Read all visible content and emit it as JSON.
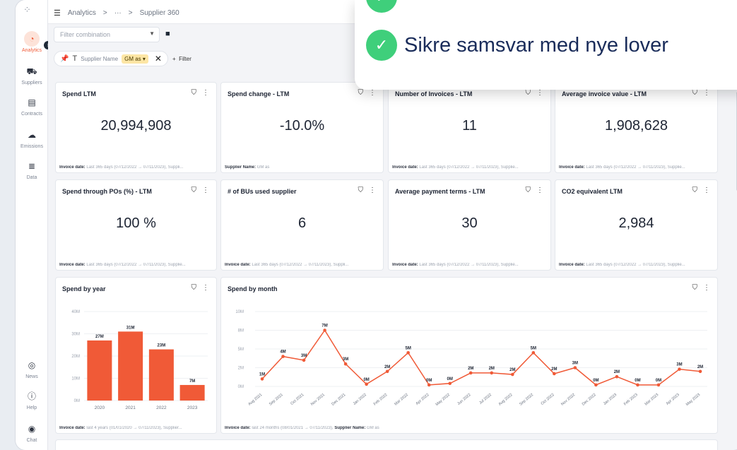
{
  "breadcrumb": {
    "root": "Analytics",
    "sep": ">",
    "ellipsis": "···",
    "current": "Supplier 360"
  },
  "sidebar": {
    "items": [
      {
        "label": "Analytics",
        "icon": "chart-icon",
        "active": true
      },
      {
        "label": "Suppliers",
        "icon": "truck-icon"
      },
      {
        "label": "Contracts",
        "icon": "document-icon"
      },
      {
        "label": "Emissions",
        "icon": "cloud-icon"
      },
      {
        "label": "Data",
        "icon": "database-icon"
      },
      {
        "label": "News",
        "icon": "news-icon"
      },
      {
        "label": "Help",
        "icon": "help-icon"
      },
      {
        "label": "Chat",
        "icon": "chat-icon"
      }
    ]
  },
  "filters": {
    "combination_placeholder": "Filter combination",
    "chip_label": "Supplier Name",
    "chip_value": "GM as",
    "add_filter": "Filter"
  },
  "kpis": [
    {
      "title": "Spend LTM",
      "value": "20,994,908",
      "foot_label": "Invoice date:",
      "foot_text": "Last 365 days (07/12/2022 → 07/11/2023), Suppli..."
    },
    {
      "title": "Spend change - LTM",
      "value": "-10.0%",
      "foot_label": "Supplier Name:",
      "foot_text": "GM as"
    },
    {
      "title": "Number of Invoices - LTM",
      "value": "11",
      "foot_label": "Invoice date:",
      "foot_text": "Last 365 days (07/12/2022 → 07/11/2023), Supplie..."
    },
    {
      "title": "Average invoice value - LTM",
      "value": "1,908,628",
      "foot_label": "Invoice date:",
      "foot_text": "Last 365 days (07/12/2022 → 07/11/2023), Supplie..."
    },
    {
      "title": "Spend through POs (%) - LTM",
      "value": "100 %",
      "foot_label": "Invoice date:",
      "foot_text": "Last 365 days (07/12/2022 → 07/11/2023), Supplie..."
    },
    {
      "title": "# of BUs used supplier",
      "value": "6",
      "foot_label": "Invoice date:",
      "foot_text": "Last 365 days (07/12/2022 → 07/11/2023), Suppli..."
    },
    {
      "title": "Average payment terms - LTM",
      "value": "30",
      "foot_label": "Invoice date:",
      "foot_text": "Last 365 days (07/12/2022 → 07/11/2023), Supplie..."
    },
    {
      "title": "CO2 equivalent LTM",
      "value": "2,984",
      "foot_label": "Invoice date:",
      "foot_text": "Last 365 days (07/12/2022 → 07/11/2023), Supplie..."
    }
  ],
  "year_card": {
    "title": "Spend by year",
    "foot_label": "Invoice date:",
    "foot_text": "last 4 years (01/01/2020 → 07/11/2023), Supplier..."
  },
  "month_card": {
    "title": "Spend by month",
    "foot_label": "Invoice date:",
    "foot_text": "last 24 months (08/01/2021 → 07/11/2023),",
    "foot_label2": "Supplier Name:",
    "foot_text2": "GM as"
  },
  "toast": {
    "line1": "",
    "line2": "Sikre samsvar med nye lover"
  },
  "colors": {
    "accent": "#f05a37",
    "success": "#3fcf7b",
    "text": "#1d2433"
  },
  "chart_data": [
    {
      "type": "bar",
      "title": "Spend by year",
      "categories": [
        "2020",
        "2021",
        "2022",
        "2023"
      ],
      "values": [
        27,
        31,
        23,
        7
      ],
      "labels": [
        "27M",
        "31M",
        "23M",
        "7M"
      ],
      "yticks": [
        "0M",
        "10M",
        "20M",
        "30M",
        "40M"
      ],
      "ylim": [
        0,
        40
      ],
      "unit": "M",
      "color": "#f05a37"
    },
    {
      "type": "line",
      "title": "Spend by month",
      "categories": [
        "Aug 2021",
        "Sep 2021",
        "Oct 2021",
        "Nov 2021",
        "Dec 2021",
        "Jan 2022",
        "Feb 2022",
        "Mar 2022",
        "Apr 2022",
        "May 2022",
        "Jun 2022",
        "Jul 2022",
        "Aug 2022",
        "Sep 2022",
        "Oct 2022",
        "Nov 2022",
        "Dec 2022",
        "Jan 2023",
        "Feb 2023",
        "Mar 2023",
        "Apr 2023",
        "May 2023"
      ],
      "values": [
        1,
        4,
        3.5,
        7.5,
        3,
        0.3,
        2,
        4.5,
        0.2,
        0.4,
        1.8,
        1.8,
        1.6,
        4.5,
        1.7,
        2.5,
        0.2,
        1.3,
        0.2,
        0.2,
        2.3,
        2
      ],
      "labels": [
        "1M",
        "4M",
        "3M",
        "7M",
        "3M",
        "0M",
        "2M",
        "5M",
        "0M",
        "0M",
        "2M",
        "2M",
        "2M",
        "5M",
        "2M",
        "3M",
        "0M",
        "2M",
        "0M",
        "0M",
        "3M",
        "2M"
      ],
      "yticks": [
        "0M",
        "2M",
        "5M",
        "8M",
        "10M"
      ],
      "ylim": [
        0,
        10
      ],
      "color": "#f05a37"
    }
  ]
}
